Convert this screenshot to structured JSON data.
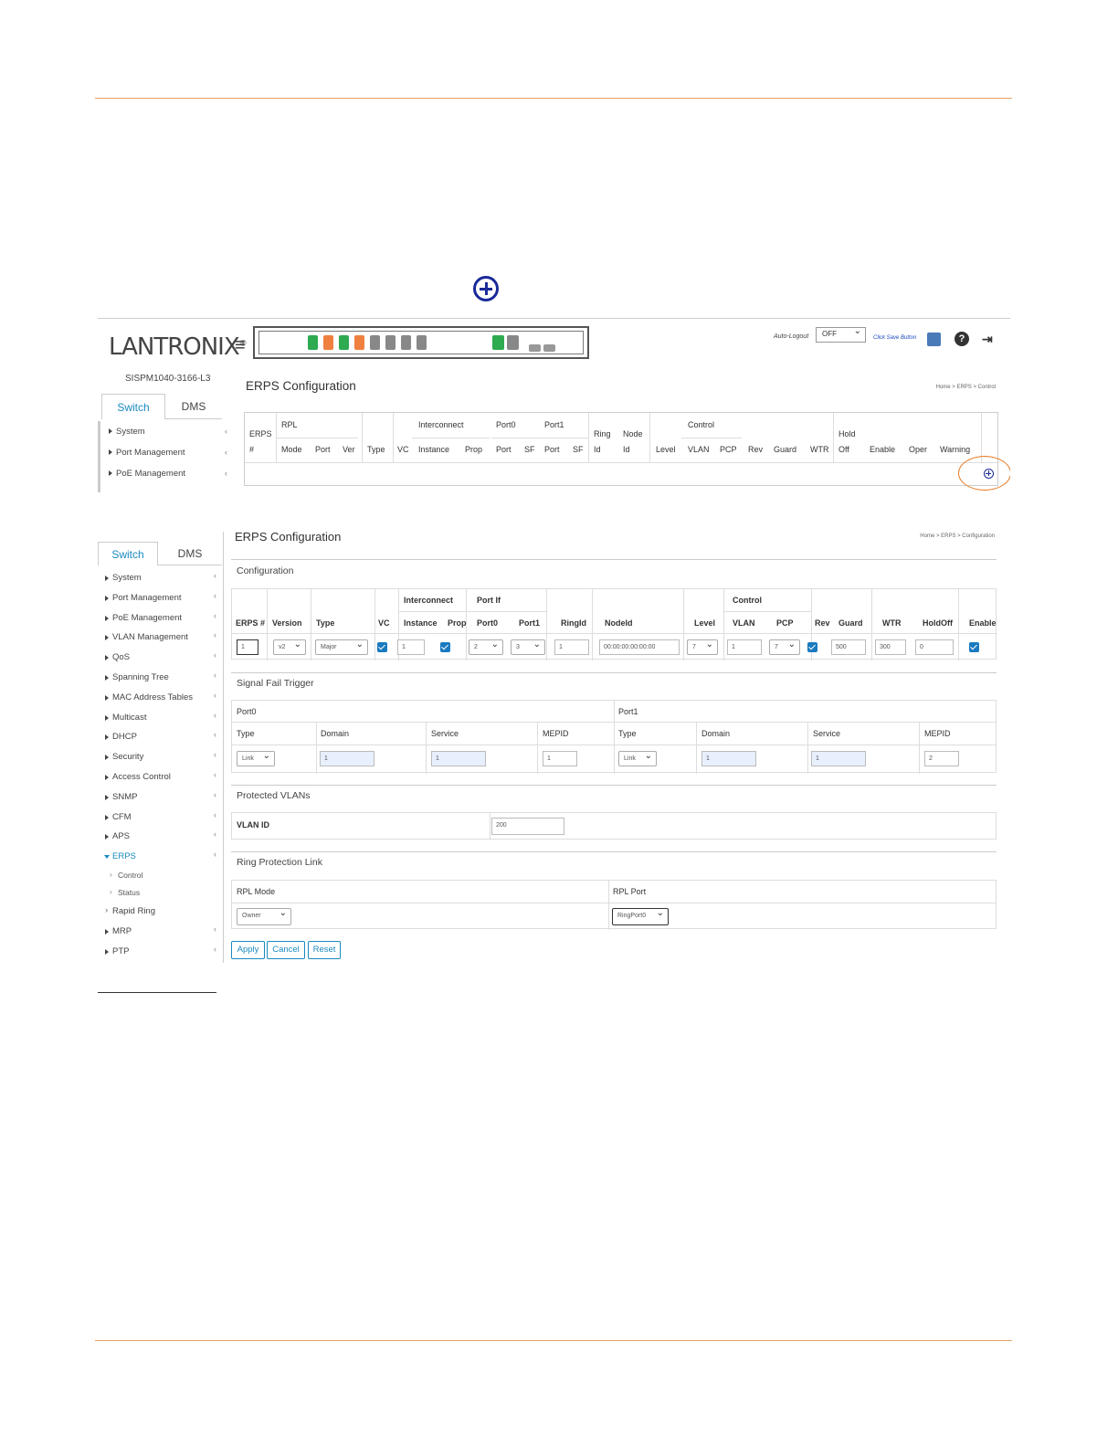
{
  "shot1": {
    "logo": "LANTRONIX",
    "logo_reg": "®",
    "device_name": "SISPM1040-3166-L3",
    "auto_logout_label": "Auto-Logout",
    "auto_logout_value": "OFF",
    "save_link": "Click Save Button",
    "tabs": [
      "Switch",
      "DMS"
    ],
    "menu": [
      "System",
      "Port Management",
      "PoE Management"
    ],
    "page_title": "ERPS Configuration",
    "breadcrumb": "Home > ERPS > Control",
    "grid_headers": {
      "erps": "ERPS",
      "hash": "#",
      "rpl": "RPL",
      "mode": "Mode",
      "port": "Port",
      "ver": "Ver",
      "type": "Type",
      "vc": "VC",
      "interconnect": "Interconnect",
      "instance": "Instance",
      "prop": "Prop",
      "port0": "Port0",
      "port0_port": "Port",
      "port0_sf": "SF",
      "port1": "Port1",
      "port1_port": "Port",
      "port1_sf": "SF",
      "ring": "Ring",
      "ring_id": "Id",
      "node": "Node",
      "node_id": "Id",
      "level": "Level",
      "control": "Control",
      "vlan": "VLAN",
      "pcp": "PCP",
      "rev": "Rev",
      "guard": "Guard",
      "wtr": "WTR",
      "hold": "Hold",
      "off": "Off",
      "enable": "Enable",
      "oper": "Oper",
      "warning": "Warning"
    }
  },
  "shot2": {
    "tabs": [
      "Switch",
      "DMS"
    ],
    "menu": [
      "System",
      "Port Management",
      "PoE Management",
      "VLAN Management",
      "QoS",
      "Spanning Tree",
      "MAC Address Tables",
      "Multicast",
      "DHCP",
      "Security",
      "Access Control",
      "SNMP",
      "CFM",
      "APS"
    ],
    "menu_active": "ERPS",
    "menu_sub": [
      "Control",
      "Status"
    ],
    "menu_after": [
      "Rapid Ring",
      "MRP",
      "PTP"
    ],
    "page_title": "ERPS Configuration",
    "breadcrumb": "Home > ERPS > Configuration",
    "config": {
      "section": "Configuration",
      "h_interconnect": "Interconnect",
      "h_portif": "Port If",
      "h_control": "Control",
      "cols": [
        "ERPS #",
        "Version",
        "Type",
        "VC",
        "Instance",
        "Prop",
        "Port0",
        "Port1",
        "RingId",
        "NodeId",
        "Level",
        "VLAN",
        "PCP",
        "Rev",
        "Guard",
        "WTR",
        "HoldOff",
        "Enable"
      ],
      "erps_num": "1",
      "version": "v2",
      "type": "Major",
      "instance": "1",
      "port0": "2",
      "port1": "3",
      "ring_id": "1",
      "node_id": "00:00:00:00:00:00",
      "level": "7",
      "vlan": "1",
      "pcp": "7",
      "guard": "500",
      "wtr": "300",
      "holdoff": "0"
    },
    "sft": {
      "section": "Signal Fail Trigger",
      "port0": "Port0",
      "port1": "Port1",
      "cols": [
        "Type",
        "Domain",
        "Service",
        "MEPID",
        "Type",
        "Domain",
        "Service",
        "MEPID"
      ],
      "p0_type": "Link",
      "p0_domain": "1",
      "p0_service": "1",
      "p0_mepid": "1",
      "p1_type": "Link",
      "p1_domain": "1",
      "p1_service": "1",
      "p1_mepid": "2"
    },
    "pvlan": {
      "section": "Protected VLANs",
      "label": "VLAN ID",
      "value": "200"
    },
    "rpl": {
      "section": "Ring Protection Link",
      "mode_label": "RPL Mode",
      "port_label": "RPL Port",
      "mode_value": "Owner",
      "port_value": "RingPort0"
    },
    "buttons": {
      "apply": "Apply",
      "cancel": "Cancel",
      "reset": "Reset"
    }
  },
  "colors": {
    "accent": "#1a8ac0",
    "orange": "#e87820",
    "plus": "#1a2a9a"
  }
}
